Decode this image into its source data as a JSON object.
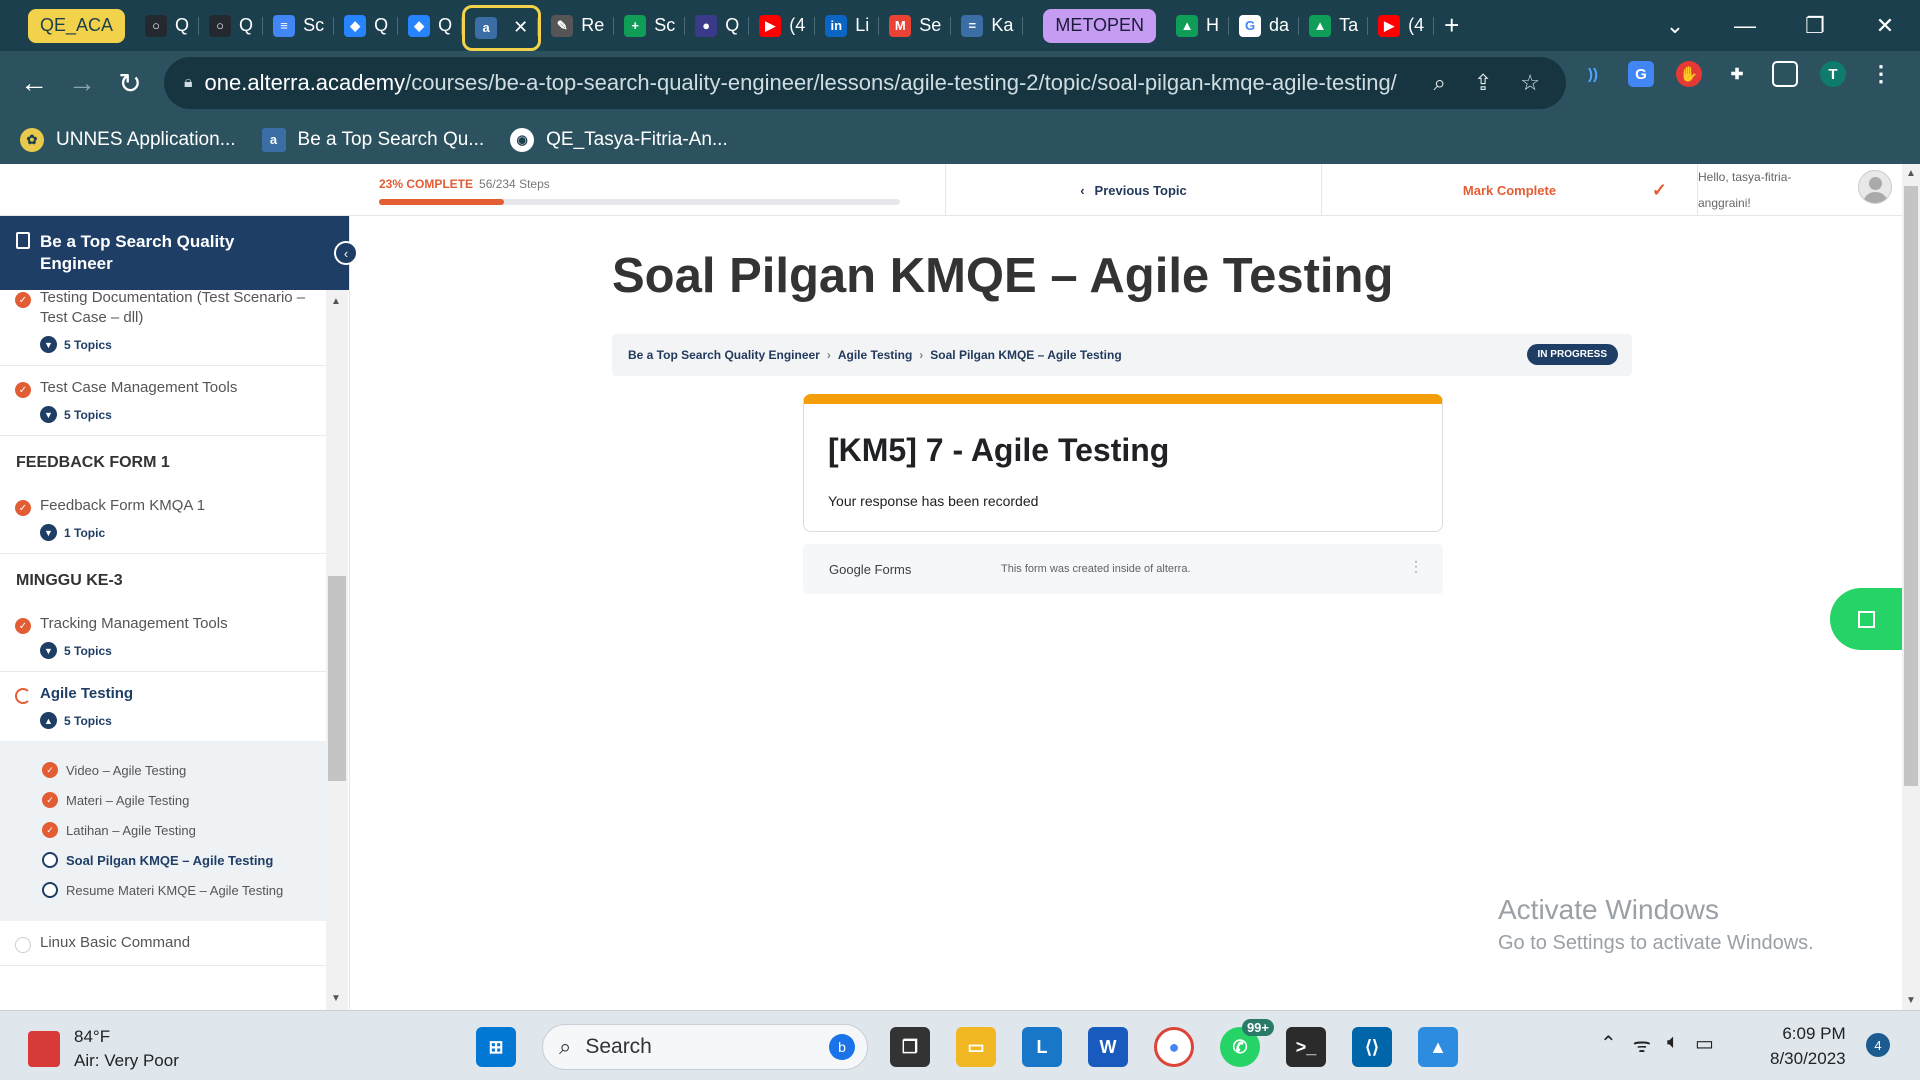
{
  "browser": {
    "tab_group_label": "QE_ACA",
    "tabs": [
      {
        "title": "Q",
        "color": "#24292f",
        "glyph": "○"
      },
      {
        "title": "Q",
        "color": "#24292f",
        "glyph": "○"
      },
      {
        "title": "Sc",
        "color": "#4285f4",
        "glyph": "≡"
      },
      {
        "title": "Q",
        "color": "#2684ff",
        "glyph": "◆"
      },
      {
        "title": "Q",
        "color": "#2684ff",
        "glyph": "◆"
      },
      {
        "title": "",
        "color": "#3a6ea5",
        "glyph": "a",
        "active": true
      },
      {
        "title": "Re",
        "color": "#555555",
        "glyph": "✎"
      },
      {
        "title": "Sc",
        "color": "#0f9d58",
        "glyph": "+"
      },
      {
        "title": "Q",
        "color": "#3a3a8a",
        "glyph": "●"
      },
      {
        "title": "(4",
        "color": "#ff0000",
        "glyph": "▶"
      },
      {
        "title": "Li",
        "color": "#0a66c2",
        "glyph": "in"
      },
      {
        "title": "Se",
        "color": "#ea4335",
        "glyph": "M"
      },
      {
        "title": "Ka",
        "color": "#3a6ea5",
        "glyph": "="
      }
    ],
    "tab_group2_label": "METOPEN",
    "tabs2": [
      {
        "title": "H",
        "color": "#0f9d58",
        "glyph": "▲"
      },
      {
        "title": "da",
        "color": "#ffffff",
        "glyph": "G"
      },
      {
        "title": "Ta",
        "color": "#0f9d58",
        "glyph": "▲"
      },
      {
        "title": "(4",
        "color": "#ff0000",
        "glyph": "▶"
      }
    ],
    "url_host": "one.alterra.academy",
    "url_path": "/courses/be-a-top-search-quality-engineer/lessons/agile-testing-2/topic/soal-pilgan-kmqe-agile-testing/",
    "profile_initial": "T",
    "bookmarks": [
      {
        "label": "UNNES Application..."
      },
      {
        "label": "Be a Top Search Qu..."
      },
      {
        "label": "QE_Tasya-Fitria-An..."
      }
    ]
  },
  "topbar": {
    "progress_pct_label": "23% COMPLETE",
    "progress_steps": "56/234 Steps",
    "progress_fraction": 0.239,
    "previous_topic": "Previous Topic",
    "mark_complete": "Mark Complete",
    "greeting": "Hello, tasya-fitria-anggraini!"
  },
  "sidebar": {
    "course_title": "Be a Top Search Quality Engineer",
    "lessons_top": [
      {
        "title": "Testing Documentation (Test Scenario – Test Case – dll)",
        "topics": "5 Topics",
        "done": true
      },
      {
        "title": "Test Case Management Tools",
        "topics": "5 Topics",
        "done": true
      }
    ],
    "section1": "FEEDBACK FORM 1",
    "lesson_feedback": {
      "title": "Feedback Form KMQA 1",
      "topics": "1 Topic"
    },
    "section2": "MINGGU KE-3",
    "lesson_tracking": {
      "title": "Tracking Management Tools",
      "topics": "5 Topics"
    },
    "lesson_active": {
      "title": "Agile Testing",
      "topics": "5 Topics"
    },
    "topics": [
      {
        "title": "Video – Agile Testing",
        "done": true
      },
      {
        "title": "Materi – Agile Testing",
        "done": true
      },
      {
        "title": "Latihan – Agile Testing",
        "done": true
      },
      {
        "title": "Soal Pilgan KMQE – Agile Testing",
        "current": true
      },
      {
        "title": "Resume Materi KMQE – Agile Testing"
      }
    ],
    "lesson_next": {
      "title": "Linux Basic Command"
    }
  },
  "main": {
    "title": "Soal Pilgan KMQE – Agile Testing",
    "breadcrumb": [
      "Be a Top Search Quality Engineer",
      "Agile Testing",
      "Soal Pilgan KMQE – Agile Testing"
    ],
    "status": "IN PROGRESS",
    "form_title": "[KM5] 7 - Agile Testing",
    "form_message": "Your response has been recorded",
    "form_brand": "Google Forms",
    "form_note": "This form was created inside of alterra."
  },
  "watermark": {
    "line1": "Activate Windows",
    "line2": "Go to Settings to activate Windows."
  },
  "taskbar": {
    "weather_temp": "84°F",
    "weather_desc": "Air: Very Poor",
    "search_placeholder": "Search",
    "whatsapp_badge": "99+",
    "time": "6:09 PM",
    "date": "8/30/2023",
    "notification_count": "4"
  }
}
